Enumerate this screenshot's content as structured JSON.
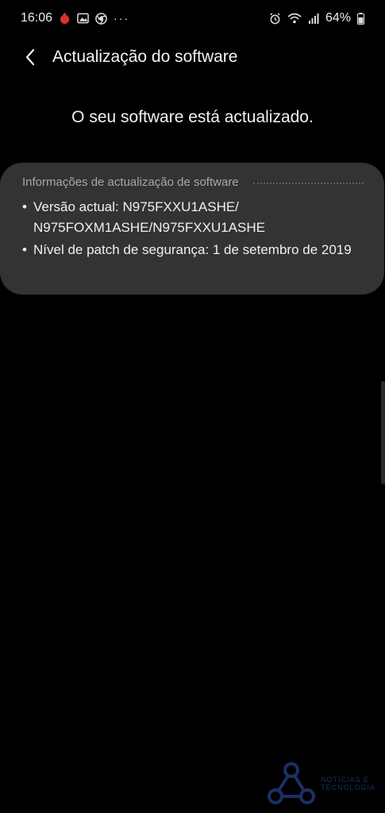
{
  "status_bar": {
    "time": "16:06",
    "more": "···",
    "battery": "64%"
  },
  "header": {
    "title": "Actualização do software"
  },
  "main": {
    "message": "O seu software está actualizado."
  },
  "info_card": {
    "title": "Informações de actualização de software",
    "items": [
      {
        "bullet": "•",
        "text": "Versão actual: N975FXXU1ASHE/ N975FOXM1ASHE/N975FXXU1ASHE"
      },
      {
        "bullet": "•",
        "text": "Nível de patch de segurança: 1 de setembro de 2019"
      }
    ]
  },
  "watermark": {
    "line1": "NOTÍCIAS E",
    "line2": "TECNOLOGIA"
  },
  "colors": {
    "background": "#000000",
    "card": "#333333",
    "card_title": "#a8a8a8",
    "text": "#f0f0f0"
  }
}
